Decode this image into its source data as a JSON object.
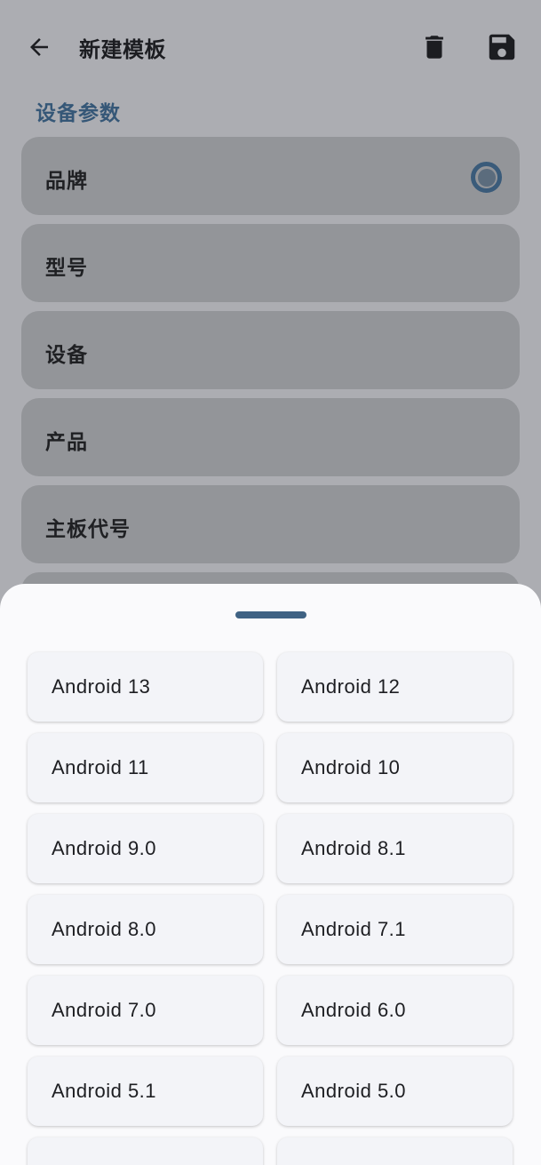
{
  "header": {
    "title": "新建模板",
    "icons": {
      "back": "arrow-left-icon",
      "delete": "trash-icon",
      "save": "floppy-disk-icon"
    }
  },
  "section": {
    "title": "设备参数"
  },
  "fields": [
    {
      "label": "品牌",
      "selected": true
    },
    {
      "label": "型号"
    },
    {
      "label": "设备"
    },
    {
      "label": "产品"
    },
    {
      "label": "主板代号"
    }
  ],
  "sheet": {
    "options": [
      "Android 13",
      "Android 12",
      "Android 11",
      "Android 10",
      "Android 9.0",
      "Android 8.1",
      "Android 8.0",
      "Android 7.1",
      "Android 7.0",
      "Android 6.0",
      "Android 5.1",
      "Android 5.0",
      "",
      ""
    ]
  },
  "colors": {
    "accent": "#3f6283",
    "scrim_bg": "#acadb2",
    "field_bg": "#939599",
    "sheet_bg": "#fafafc",
    "chip_bg": "#f3f4f8"
  }
}
